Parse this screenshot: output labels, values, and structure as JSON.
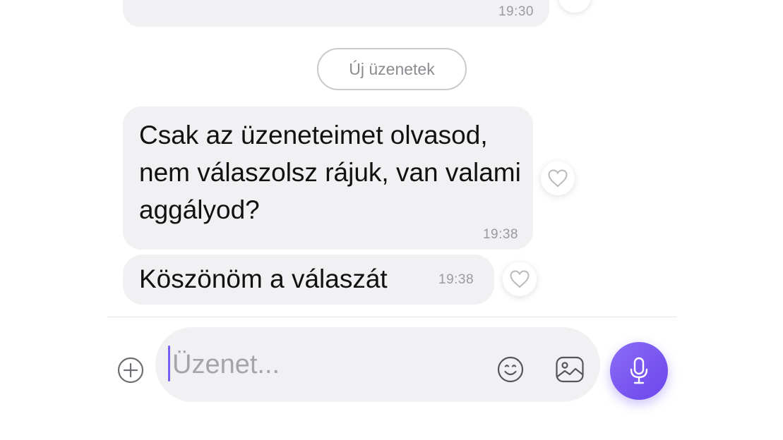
{
  "previous_message": {
    "time": "19:30"
  },
  "divider": {
    "label": "Új üzenetek"
  },
  "messages": [
    {
      "text": "Csak az üzeneteimet olvasod, nem válaszolsz rájuk, van valami aggályod?",
      "time": "19:38",
      "reaction_icon": "heart-icon"
    },
    {
      "text": "Köszönöm a válaszát",
      "time": "19:38",
      "reaction_icon": "heart-icon"
    }
  ],
  "composer": {
    "placeholder": "Üzenet...",
    "value": "",
    "left_icon": "plus-circle-icon",
    "emoji_icon": "smiley-icon",
    "image_icon": "image-icon",
    "send_icon": "microphone-icon"
  },
  "colors": {
    "bubble": "#f1f1f3",
    "accent": "#7b5cf5",
    "timestamp": "#9a9a9f"
  }
}
